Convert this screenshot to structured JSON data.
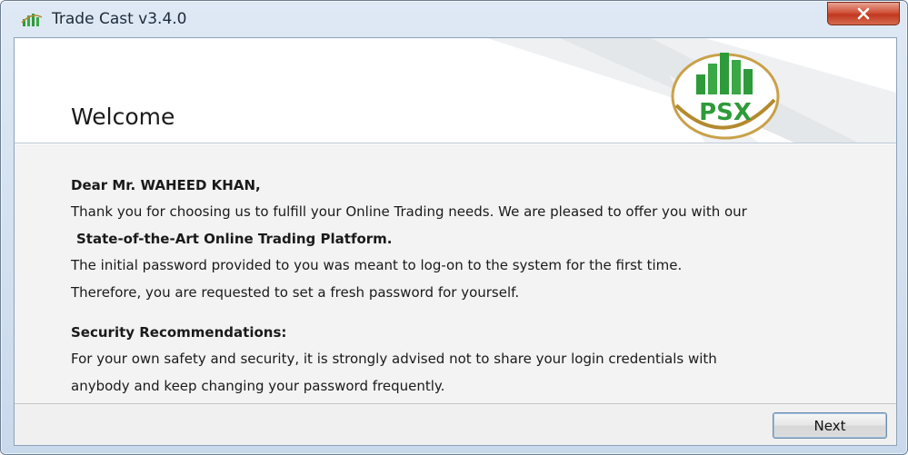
{
  "window": {
    "title": "Trade Cast v3.4.0",
    "close_icon": "close-icon"
  },
  "header": {
    "heading": "Welcome",
    "logo_text": "PSX",
    "logo_icon": "psx-logo"
  },
  "content": {
    "salutation": "Dear Mr. WAHEED KHAN,",
    "paragraph1_line1": "Thank you for choosing us to fulfill your Online Trading needs. We are pleased to offer you with our",
    "paragraph1_line2": "State-of-the-Art  Online Trading Platform.",
    "paragraph2_line1": "The initial password provided to you was meant to log-on to the system for the first time.",
    "paragraph2_line2": "Therefore, you are requested to set a fresh password for yourself.",
    "security_heading": "Security Recommendations:",
    "security_line1": "For your own safety and security, it is strongly advised not to share your login credentials with",
    "security_line2": "anybody and keep changing your password frequently."
  },
  "footer": {
    "next_label": "Next"
  },
  "colors": {
    "logo_green": "#2e9b3a",
    "logo_gold": "#b38a2e",
    "close_red": "#c0381f"
  }
}
